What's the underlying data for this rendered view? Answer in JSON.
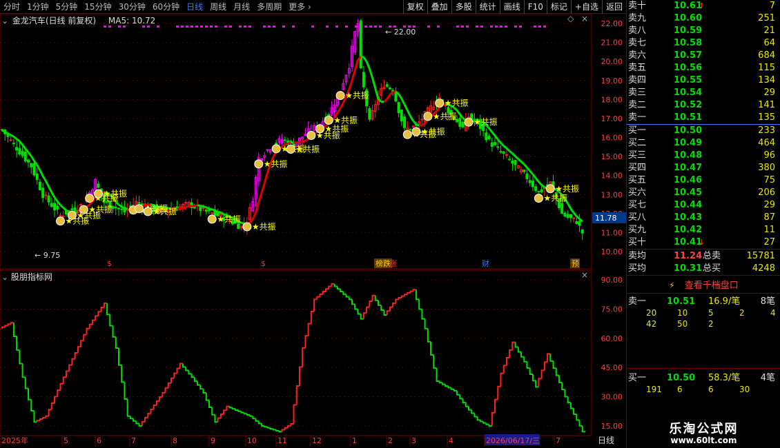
{
  "toolbar": {
    "periods": [
      "分时",
      "1分钟",
      "5分钟",
      "15分钟",
      "30分钟",
      "60分钟",
      "日线",
      "周线",
      "月线",
      "多周期",
      "更多 ›"
    ],
    "active_period": "日线",
    "buttons": [
      "复权",
      "叠加",
      "多股",
      "统计",
      "画线",
      "F10",
      "标记",
      "+自选",
      "返回"
    ]
  },
  "chart_title": "金龙汽车(日线 前复权)",
  "ma_label": "MA5: 10.72",
  "max_marker": "22.00",
  "min_marker": "9.75",
  "last_price_tag": "11.78",
  "resonance_text": "共振",
  "event_marks": [
    "$",
    "$",
    "榜跌",
    "涨",
    "财",
    "预"
  ],
  "indicator_title": "股朋指标网",
  "x_axis_labels": [
    "2025年",
    "5",
    "6",
    "7",
    "8",
    "9",
    "10",
    "11",
    "12",
    "1",
    "2",
    "3",
    "4",
    "2026/06/17/三",
    "7"
  ],
  "period_footer": "日线",
  "colors": {
    "up": "#ff2020",
    "down": "#00e000",
    "ma_up": "#e00000",
    "ma_down": "#00e000",
    "magenta": "#ff00ff",
    "axis": "#7a0000",
    "grid": "#600000"
  },
  "chart_data": [
    {
      "type": "candlestick",
      "title": "金龙汽车(日线 前复权)",
      "ylim": [
        9.75,
        22.0
      ],
      "y_ticks": [
        10.0,
        11.0,
        12.0,
        13.0,
        14.0,
        15.0,
        16.0,
        17.0,
        18.0,
        19.0,
        20.0,
        21.0,
        22.0
      ],
      "max": 22.0,
      "min": 9.75,
      "last": 11.78,
      "ma5": 10.72
    },
    {
      "type": "line",
      "title": "股朋指标网",
      "ylim": [
        10,
        95
      ],
      "y_ticks": [
        15.0,
        30.0,
        45.0,
        60.0,
        75.0,
        90.0
      ]
    }
  ],
  "order_book": {
    "asks": [
      {
        "label": "卖十",
        "price": "10.61",
        "vol": "7",
        "arrow": "↑"
      },
      {
        "label": "卖九",
        "price": "10.60",
        "vol": "251"
      },
      {
        "label": "卖八",
        "price": "10.59",
        "vol": "21"
      },
      {
        "label": "卖七",
        "price": "10.58",
        "vol": "64"
      },
      {
        "label": "卖六",
        "price": "10.57",
        "vol": "684"
      },
      {
        "label": "卖五",
        "price": "10.56",
        "vol": "115"
      },
      {
        "label": "卖四",
        "price": "10.55",
        "vol": "134"
      },
      {
        "label": "卖三",
        "price": "10.54",
        "vol": "29"
      },
      {
        "label": "卖二",
        "price": "10.52",
        "vol": "141"
      },
      {
        "label": "卖一",
        "price": "10.51",
        "vol": "135"
      }
    ],
    "bids": [
      {
        "label": "买一",
        "price": "10.50",
        "vol": "233"
      },
      {
        "label": "买二",
        "price": "10.49",
        "vol": "464"
      },
      {
        "label": "买三",
        "price": "10.48",
        "vol": "96"
      },
      {
        "label": "买四",
        "price": "10.47",
        "vol": "380"
      },
      {
        "label": "买五",
        "price": "10.46",
        "vol": "75"
      },
      {
        "label": "买六",
        "price": "10.45",
        "vol": "206"
      },
      {
        "label": "买七",
        "price": "10.44",
        "vol": "29"
      },
      {
        "label": "买八",
        "price": "10.43",
        "vol": "87"
      },
      {
        "label": "买九",
        "price": "10.42",
        "vol": "11"
      },
      {
        "label": "买十",
        "price": "10.41",
        "vol": "27",
        "arrow": "↓"
      }
    ],
    "avg_ask": {
      "label": "卖均",
      "price": "11.24",
      "tlabel": "总卖",
      "total": "15781"
    },
    "avg_bid": {
      "label": "买均",
      "price": "10.31",
      "tlabel": "总买",
      "total": "4248"
    },
    "depth_button": "查看千档盘口",
    "sell_queue": {
      "label": "卖一",
      "price": "10.51",
      "per": "16.9/笔",
      "count": "8笔",
      "orders": [
        "20",
        "10",
        "5",
        "2",
        "4",
        "42",
        "50",
        "2"
      ]
    },
    "buy_queue": {
      "label": "买一",
      "price": "10.50",
      "per": "58.3/笔",
      "count": "4笔",
      "orders": [
        "191",
        "6",
        "6",
        "30"
      ]
    }
  },
  "watermark": {
    "name": "乐淘公式网",
    "url": "www.60lt.com"
  }
}
